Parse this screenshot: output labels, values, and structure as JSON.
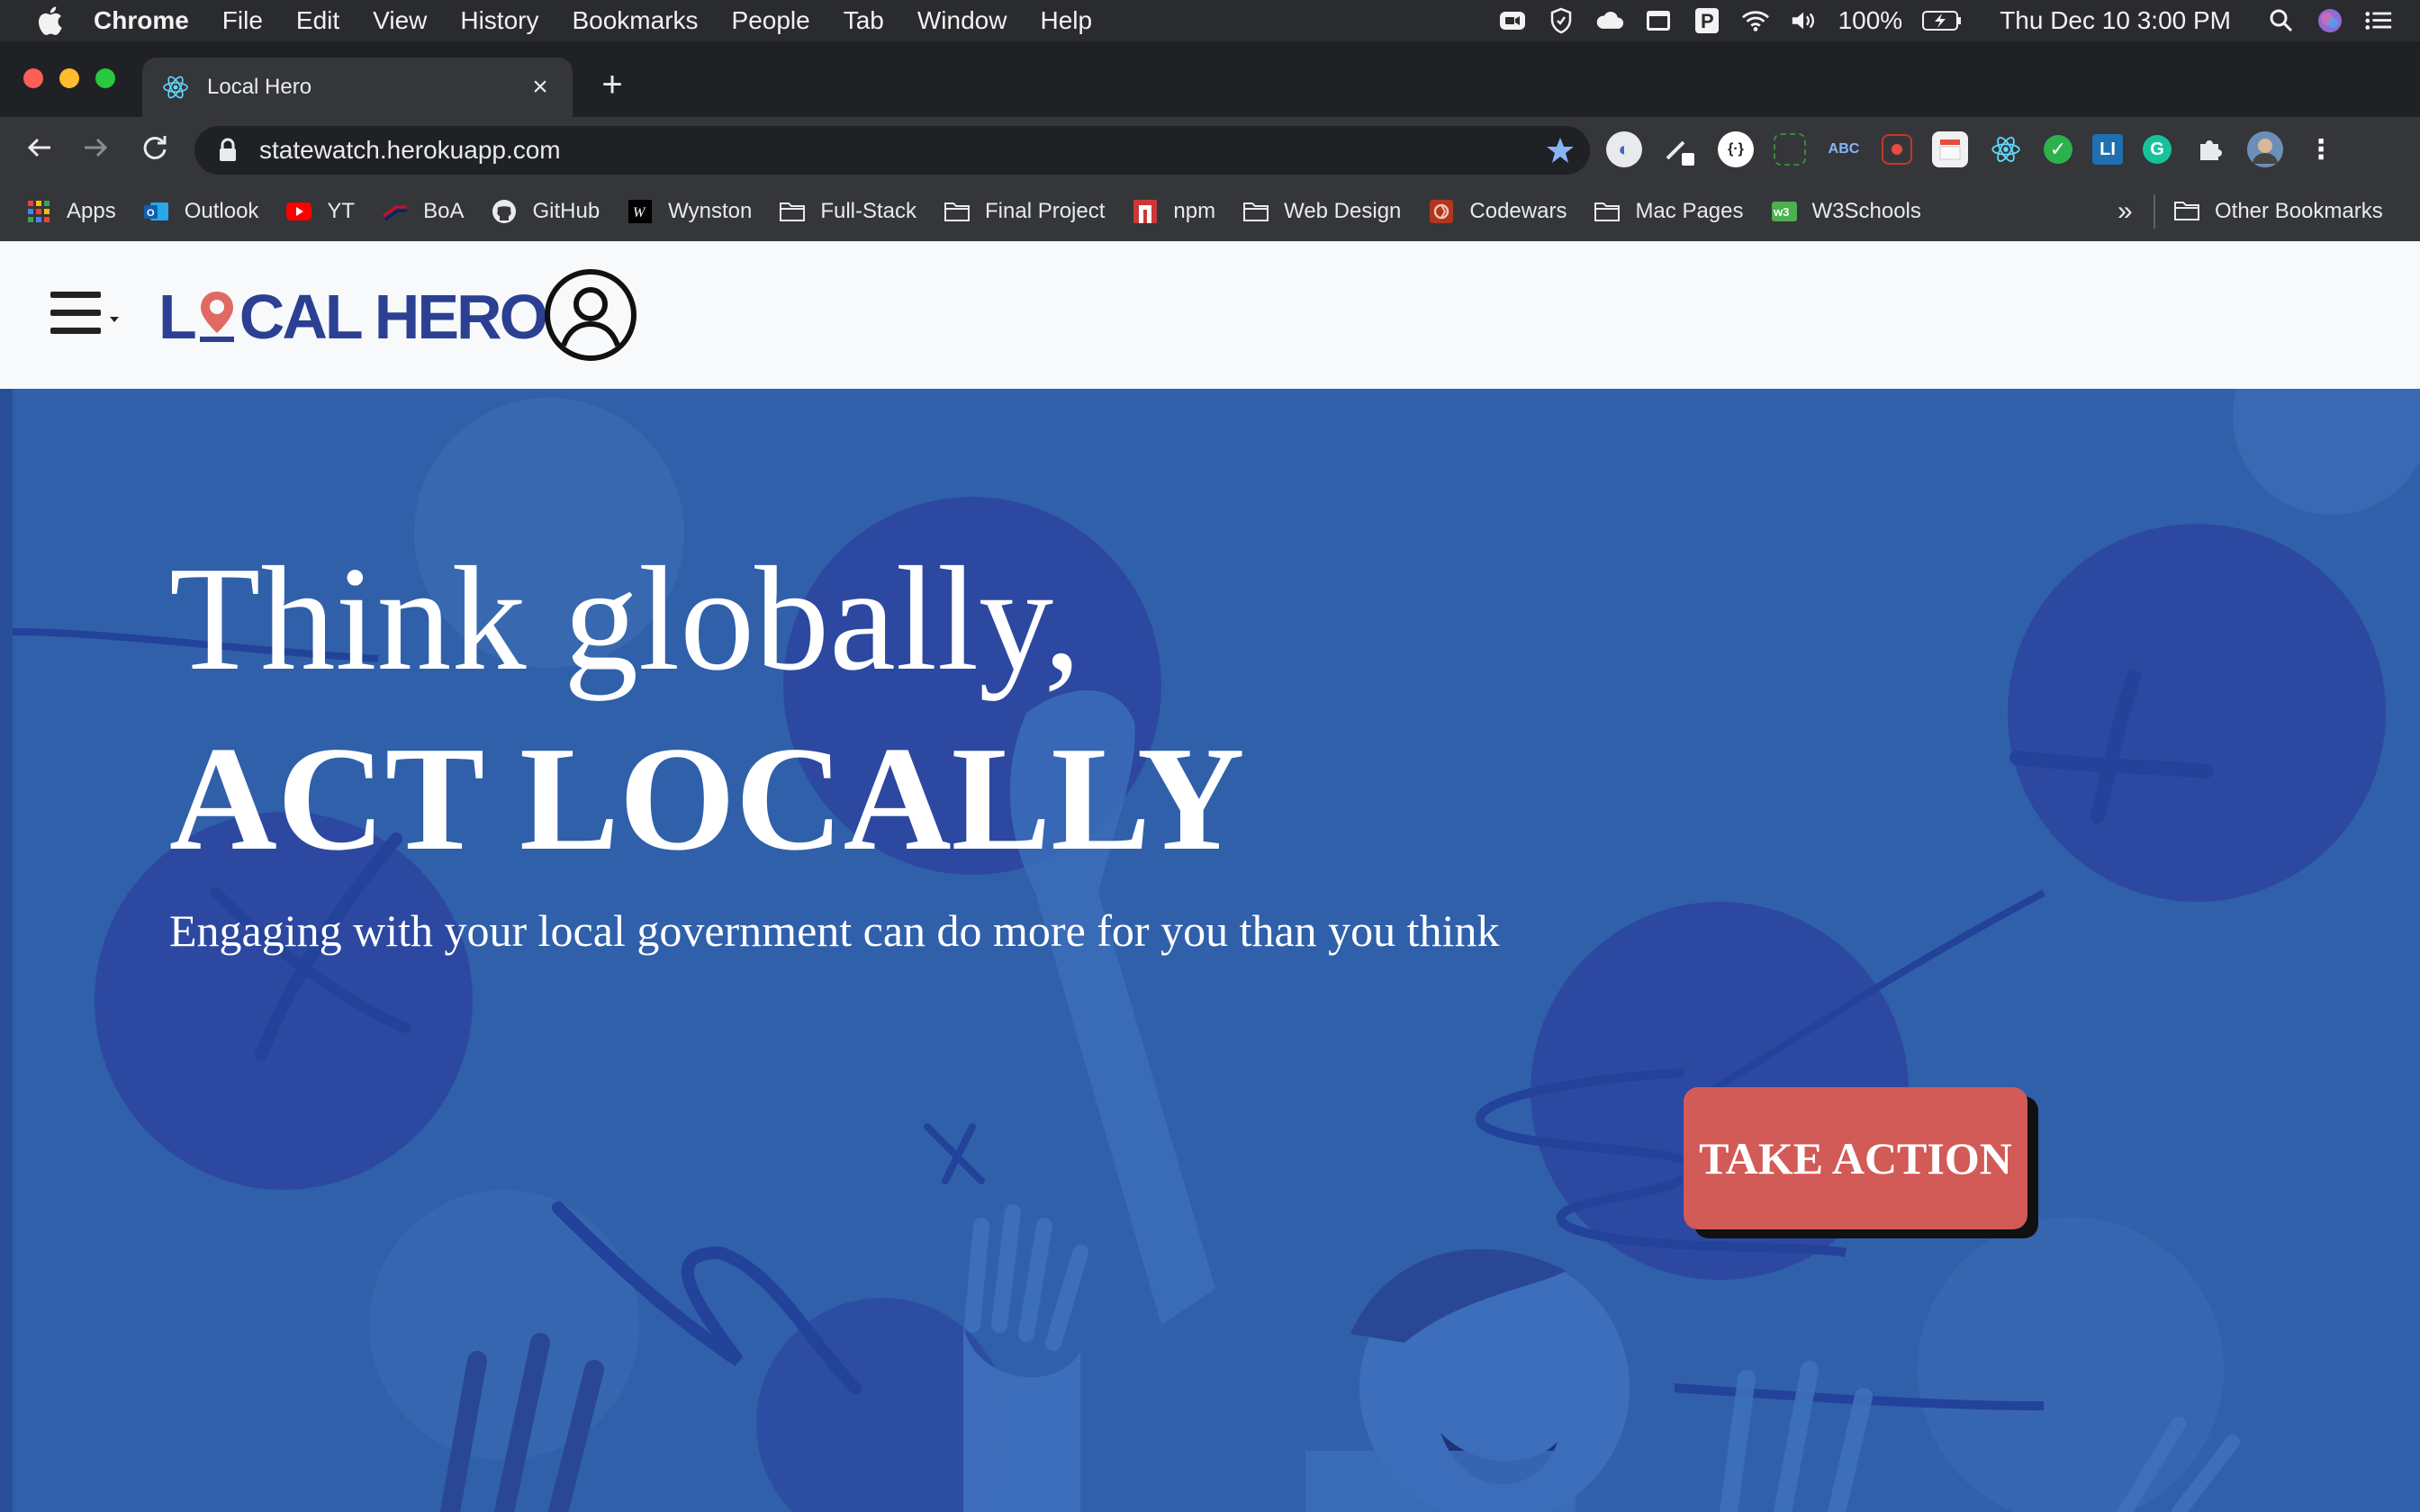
{
  "menubar": {
    "app": "Chrome",
    "items": [
      "File",
      "Edit",
      "View",
      "History",
      "Bookmarks",
      "People",
      "Tab",
      "Window",
      "Help"
    ],
    "battery": "100%",
    "datetime": "Thu Dec 10  3:00 PM"
  },
  "browser": {
    "tab_title": "Local Hero",
    "url": "statewatch.herokuapp.com",
    "bookmarks": [
      {
        "label": "Apps",
        "icon": "apps-grid-icon"
      },
      {
        "label": "Outlook",
        "icon": "outlook-icon"
      },
      {
        "label": "YT",
        "icon": "youtube-icon"
      },
      {
        "label": "BoA",
        "icon": "boa-icon"
      },
      {
        "label": "GitHub",
        "icon": "github-icon"
      },
      {
        "label": "Wynston",
        "icon": "wynston-icon"
      },
      {
        "label": "Full-Stack",
        "icon": "folder-icon"
      },
      {
        "label": "Final Project",
        "icon": "folder-icon"
      },
      {
        "label": "npm",
        "icon": "npm-icon"
      },
      {
        "label": "Web Design",
        "icon": "folder-icon"
      },
      {
        "label": "Codewars",
        "icon": "codewars-icon"
      },
      {
        "label": "Mac Pages",
        "icon": "folder-icon"
      },
      {
        "label": "W3Schools",
        "icon": "w3schools-icon"
      }
    ],
    "overflow": "»",
    "other_bookmarks": "Other Bookmarks"
  },
  "site": {
    "logo_left": "L",
    "logo_right": "CAL HERO",
    "hero": {
      "title_line1": "Think globally,",
      "title_line2": "ACT LOCALLY",
      "subtitle": "Engaging with your local government can do more for you than you think",
      "cta": "TAKE ACTION"
    }
  },
  "colors": {
    "hero_blue": "#3060aa",
    "brand_navy": "#2b3f93",
    "cta_red": "#d25a57",
    "header_bg": "#f8f9fa"
  }
}
